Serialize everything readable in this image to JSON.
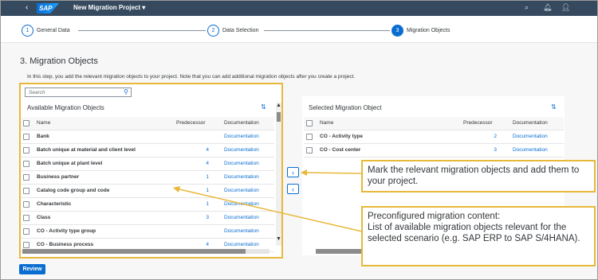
{
  "shell": {
    "back": "‹",
    "logo": "SAP",
    "title": "New Migration Project ▾",
    "icons": [
      "⌕",
      "🔔︎",
      "👤︎"
    ]
  },
  "wizard": {
    "steps": [
      {
        "num": "1",
        "label": "General Data"
      },
      {
        "num": "2",
        "label": "Data Selection"
      },
      {
        "num": "3",
        "label": "Migration Objects"
      }
    ]
  },
  "page": {
    "heading": "3. Migration Objects",
    "intro": "In this step, you add the relevant migration objects to your project. Note that you can add additional migration objects after you create a project."
  },
  "available": {
    "search_placeholder": "Search",
    "title": "Available Migration Objects",
    "headers": {
      "name": "Name",
      "pred": "Predecessor",
      "doc": "Documentation"
    },
    "rows": [
      {
        "name": "Bank",
        "pred": "",
        "doc": "Documentation"
      },
      {
        "name": "Batch unique at material and client level",
        "pred": "4",
        "doc": "Documentation"
      },
      {
        "name": "Batch unique at plant level",
        "pred": "4",
        "doc": "Documentation"
      },
      {
        "name": "Business partner",
        "pred": "1",
        "doc": "Documentation"
      },
      {
        "name": "Catalog code group and code",
        "pred": "1",
        "doc": "Documentation"
      },
      {
        "name": "Characteristic",
        "pred": "1",
        "doc": "Documentation"
      },
      {
        "name": "Class",
        "pred": "3",
        "doc": "Documentation"
      },
      {
        "name": "CO - Activity type group",
        "pred": "",
        "doc": "Documentation"
      },
      {
        "name": "CO - Business process",
        "pred": "4",
        "doc": "Documentation"
      }
    ]
  },
  "selected": {
    "title": "Selected Migration Object",
    "headers": {
      "name": "Name",
      "pred": "Predecessor",
      "doc": "Documentation"
    },
    "rows": [
      {
        "name": "CO - Activity type",
        "pred": "2",
        "doc": "Documentation"
      },
      {
        "name": "CO - Cost center",
        "pred": "3",
        "doc": "Documentation"
      }
    ]
  },
  "buttons": {
    "add": "›",
    "remove": "‹",
    "review": "Review",
    "sort": "⇅",
    "scroll_up": "▲",
    "scroll_down": "▼"
  },
  "callouts": {
    "mark": "Mark the relevant migration objects and add them to your project.",
    "preconfig_title": "Preconfigured migration content:",
    "preconfig_body": "List of available migration objects relevant for the selected scenario (e.g. SAP ERP to SAP S/4HANA)."
  },
  "colors": {
    "shell": "#354a5f",
    "accent": "#0a6ed1",
    "highlight": "#e8b83a"
  }
}
